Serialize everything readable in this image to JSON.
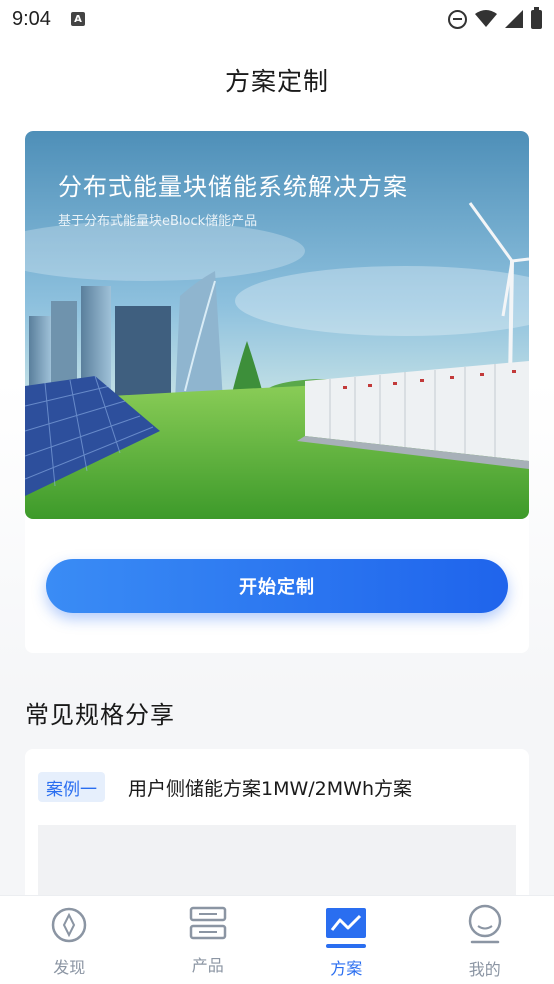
{
  "status_bar": {
    "time": "9:04",
    "notification_icon_letter": "A"
  },
  "header": {
    "title": "方案定制"
  },
  "hero": {
    "title": "分布式能量块储能系统解决方案",
    "subtitle": "基于分布式能量块eBlock储能产品",
    "button_label": "开始定制"
  },
  "section": {
    "title": "常见规格分享"
  },
  "cases": [
    {
      "tag": "案例一",
      "title": "用户侧储能方案1MW/2MWh方案"
    }
  ],
  "tabs": [
    {
      "label": "发现",
      "icon": "compass-icon",
      "active": false
    },
    {
      "label": "产品",
      "icon": "server-icon",
      "active": false
    },
    {
      "label": "方案",
      "icon": "chart-wave-icon",
      "active": true
    },
    {
      "label": "我的",
      "icon": "user-icon",
      "active": false
    }
  ],
  "colors": {
    "accent": "#2a6ef0",
    "tab_inactive": "#8b95a3",
    "tag_bg": "#e6effc"
  }
}
